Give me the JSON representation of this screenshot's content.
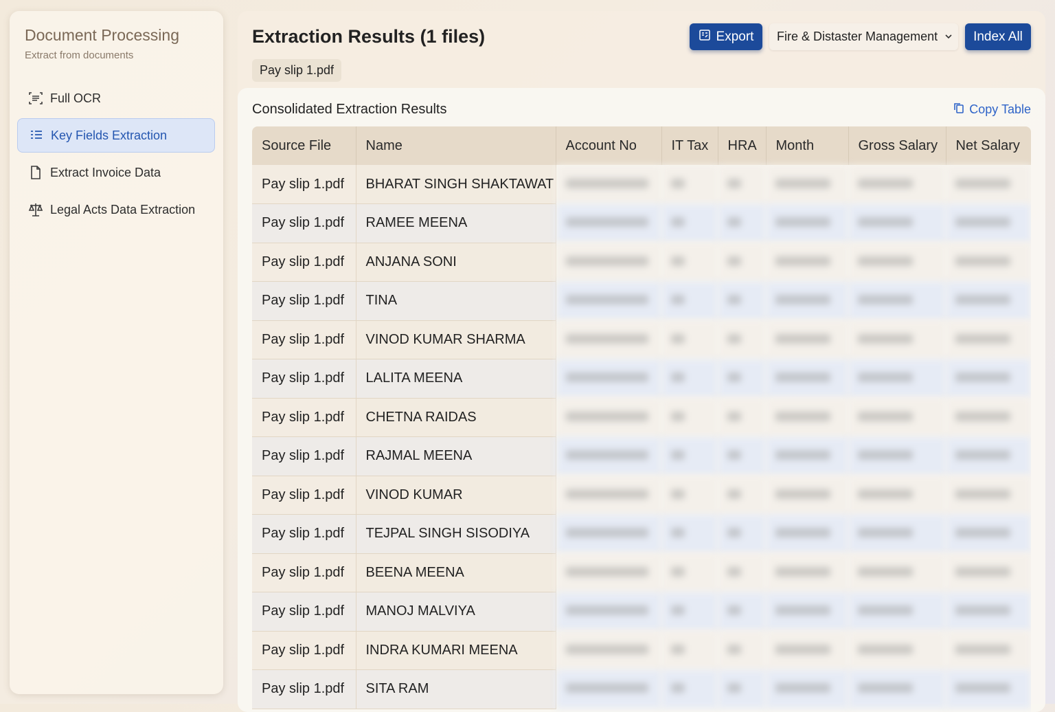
{
  "sidebar": {
    "title": "Document Processing",
    "subtitle": "Extract from documents",
    "items": [
      {
        "label": "Full OCR",
        "icon": "scan-text-icon",
        "active": false
      },
      {
        "label": "Key Fields Extraction",
        "icon": "list-icon",
        "active": true
      },
      {
        "label": "Extract Invoice Data",
        "icon": "document-icon",
        "active": false
      },
      {
        "label": "Legal Acts Data Extraction",
        "icon": "scale-icon",
        "active": false
      }
    ]
  },
  "header": {
    "title": "Extraction Results (1 files)",
    "file_chip": "Pay slip 1.pdf",
    "export_label": "Export",
    "dropdown_value": "Fire & Distaster Management",
    "index_label": "Index All"
  },
  "results": {
    "title": "Consolidated Extraction Results",
    "copy_label": "Copy Table",
    "columns": [
      "Source File",
      "Name",
      "Account No",
      "IT Tax",
      "HRA",
      "Month",
      "Gross Salary",
      "Net Salary"
    ],
    "rows": [
      {
        "source": "Pay slip 1.pdf",
        "name": "BHARAT SINGH SHAKTAWAT"
      },
      {
        "source": "Pay slip 1.pdf",
        "name": "RAMEE MEENA"
      },
      {
        "source": "Pay slip 1.pdf",
        "name": "ANJANA SONI"
      },
      {
        "source": "Pay slip 1.pdf",
        "name": "TINA"
      },
      {
        "source": "Pay slip 1.pdf",
        "name": "VINOD KUMAR SHARMA"
      },
      {
        "source": "Pay slip 1.pdf",
        "name": "LALITA MEENA"
      },
      {
        "source": "Pay slip 1.pdf",
        "name": "CHETNA RAIDAS"
      },
      {
        "source": "Pay slip 1.pdf",
        "name": "RAJMAL MEENA"
      },
      {
        "source": "Pay slip 1.pdf",
        "name": "VINOD KUMAR"
      },
      {
        "source": "Pay slip 1.pdf",
        "name": "TEJPAL SINGH SISODIYA"
      },
      {
        "source": "Pay slip 1.pdf",
        "name": "BEENA MEENA"
      },
      {
        "source": "Pay slip 1.pdf",
        "name": "MANOJ MALVIYA"
      },
      {
        "source": "Pay slip 1.pdf",
        "name": "INDRA KUMARI MEENA"
      },
      {
        "source": "Pay slip 1.pdf",
        "name": "SITA RAM"
      }
    ]
  },
  "colors": {
    "accent": "#1c4a9a",
    "active_nav_bg": "#dde6f7",
    "link": "#2f64c8"
  }
}
